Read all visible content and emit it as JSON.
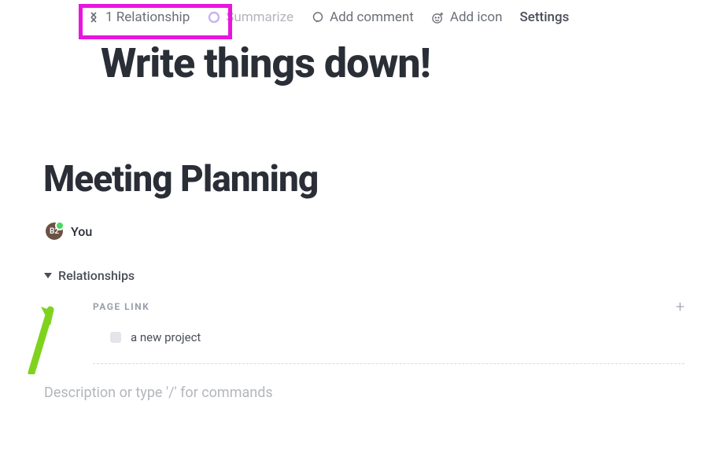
{
  "toolbar": {
    "relationship": {
      "count": 1,
      "label": "1 Relationship"
    },
    "summarize": "Summarize",
    "add_comment": "Add comment",
    "add_icon": "Add icon",
    "settings": "Settings"
  },
  "hero_text": "Write things down!",
  "page_title": "Meeting Planning",
  "byline": {
    "avatar_initials": "B2",
    "name": "You"
  },
  "relationships": {
    "section_label": "Relationships",
    "group_label": "PAGE LINK",
    "items": [
      {
        "title": "a new project"
      }
    ]
  },
  "description_placeholder": "Description or type '/' for commands"
}
